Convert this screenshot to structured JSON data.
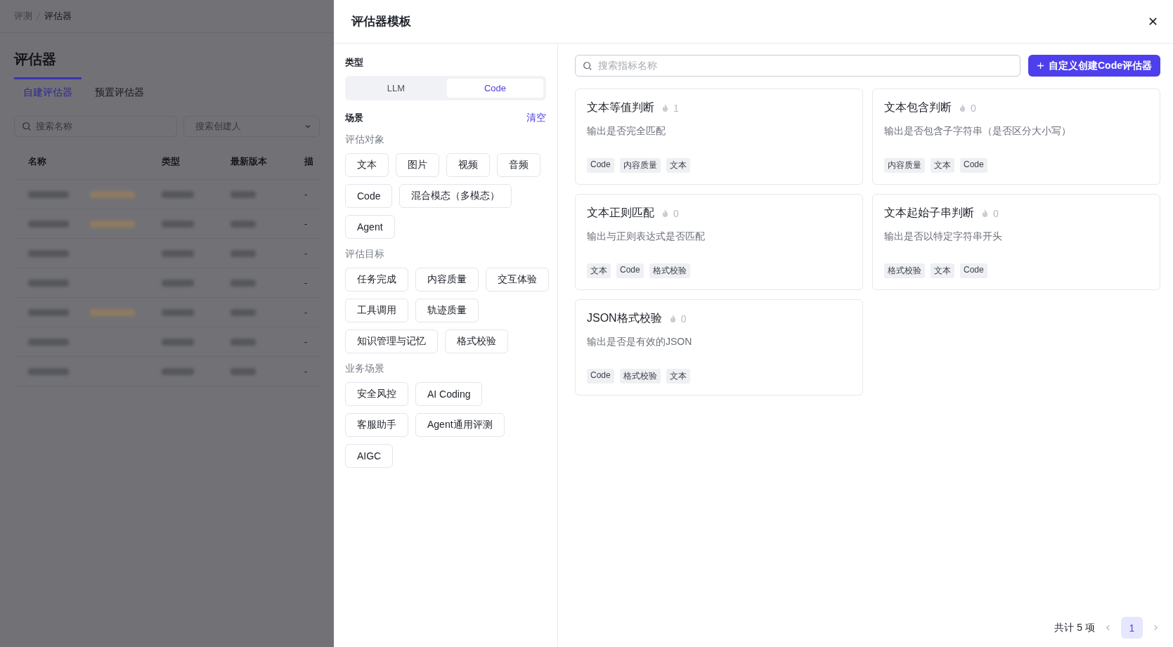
{
  "background_page": {
    "breadcrumb": [
      "评测",
      "评估器"
    ],
    "title": "评估器",
    "tabs": [
      {
        "label": "自建评估器",
        "selected": true
      },
      {
        "label": "预置评估器",
        "selected": false
      }
    ],
    "search": {
      "placeholder": "搜索名称"
    },
    "creator_select": {
      "placeholder": "搜索创建人"
    },
    "table": {
      "columns": [
        "名称",
        "类型",
        "最新版本",
        "描"
      ],
      "rows": [
        {
          "tagged": true,
          "description": "-"
        },
        {
          "tagged": true,
          "description": "-"
        },
        {
          "tagged": false,
          "description": "-"
        },
        {
          "tagged": false,
          "description": "-"
        },
        {
          "tagged": true,
          "description": "-"
        },
        {
          "tagged": false,
          "description": "-"
        },
        {
          "tagged": false,
          "description": "-"
        }
      ]
    }
  },
  "drawer": {
    "title": "评估器模板",
    "filters": {
      "type_label": "类型",
      "types": [
        {
          "label": "LLM",
          "selected": false
        },
        {
          "label": "Code",
          "selected": true
        }
      ],
      "scene_label": "场景",
      "clear": "清空",
      "groups": [
        {
          "title": "评估对象",
          "chips": [
            {
              "label": "文本",
              "selected": false
            },
            {
              "label": "图片",
              "selected": false
            },
            {
              "label": "视频",
              "selected": false
            },
            {
              "label": "音频",
              "selected": false
            },
            {
              "label": "Code",
              "selected": false
            },
            {
              "label": "混合模态（多模态）",
              "selected": false
            },
            {
              "label": "Agent",
              "selected": false
            }
          ]
        },
        {
          "title": "评估目标",
          "chips": [
            {
              "label": "任务完成",
              "selected": false
            },
            {
              "label": "内容质量",
              "selected": false
            },
            {
              "label": "交互体验",
              "selected": false
            },
            {
              "label": "工具调用",
              "selected": false
            },
            {
              "label": "轨迹质量",
              "selected": false
            },
            {
              "label": "知识管理与记忆",
              "selected": false
            },
            {
              "label": "格式校验",
              "selected": false
            }
          ]
        },
        {
          "title": "业务场景",
          "chips": [
            {
              "label": "安全风控",
              "selected": false
            },
            {
              "label": "AI Coding",
              "selected": false
            },
            {
              "label": "客服助手",
              "selected": false
            },
            {
              "label": "Agent通用评测",
              "selected": false
            },
            {
              "label": "AIGC",
              "selected": false
            }
          ]
        }
      ]
    },
    "search": {
      "placeholder": "搜索指标名称"
    },
    "create_button": "自定义创建Code评估器",
    "cards": [
      {
        "title": "文本等值判断",
        "count": "1",
        "description": "输出是否完全匹配",
        "tags": [
          "Code",
          "内容质量",
          "文本"
        ]
      },
      {
        "title": "文本包含判断",
        "count": "0",
        "description": "输出是否包含子字符串（是否区分大小写）",
        "tags": [
          "内容质量",
          "文本",
          "Code"
        ]
      },
      {
        "title": "文本正则匹配",
        "count": "0",
        "description": "输出与正则表达式是否匹配",
        "tags": [
          "文本",
          "Code",
          "格式校验"
        ]
      },
      {
        "title": "文本起始子串判断",
        "count": "0",
        "description": "输出是否以特定字符串开头",
        "tags": [
          "格式校验",
          "文本",
          "Code"
        ]
      },
      {
        "title": "JSON格式校验",
        "count": "0",
        "description": "输出是否是有效的JSON",
        "tags": [
          "Code",
          "格式校验",
          "文本"
        ]
      }
    ],
    "pagination": {
      "total": "共计 5 项",
      "pages": [
        {
          "label": "1",
          "selected": true
        }
      ]
    }
  }
}
